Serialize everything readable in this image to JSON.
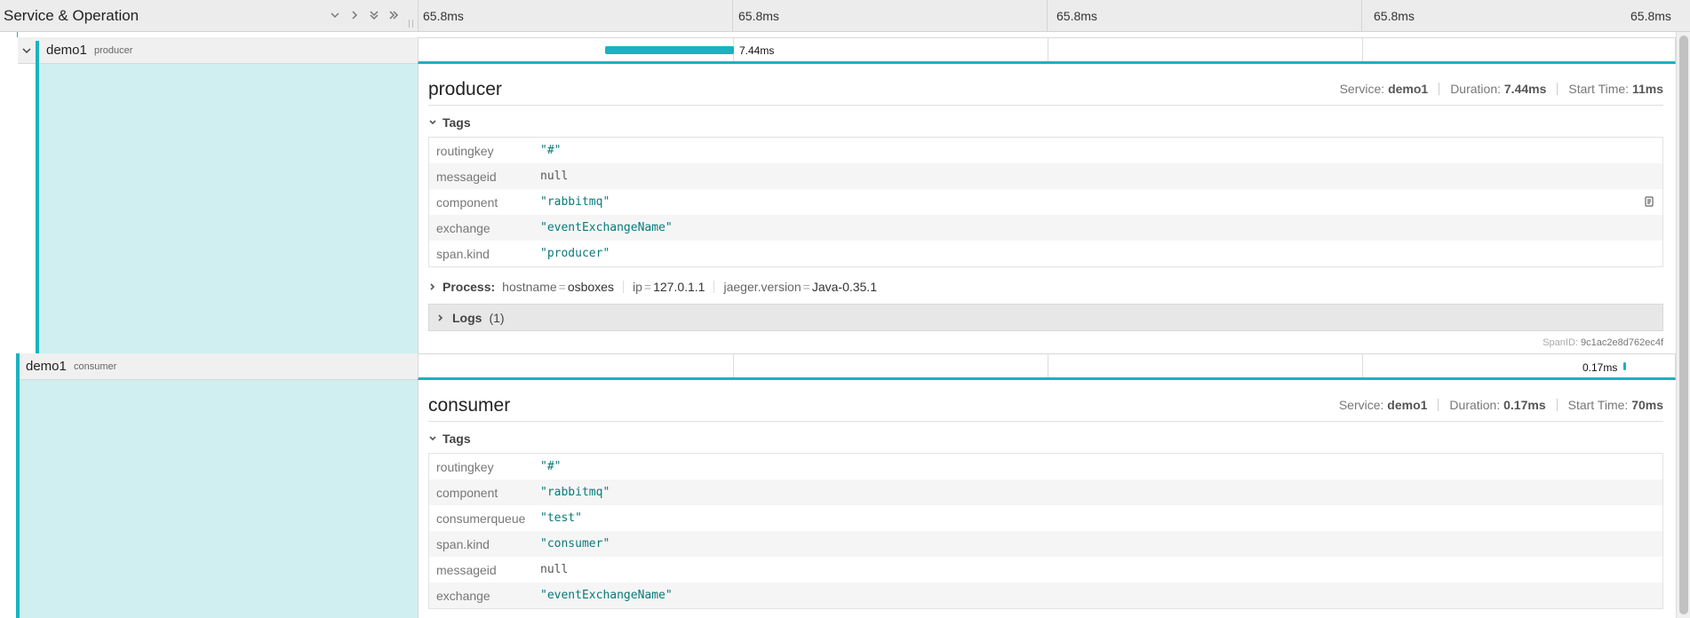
{
  "header": {
    "title": "Service & Operation",
    "ticks": [
      "65.8ms",
      "65.8ms",
      "65.8ms",
      "65.8ms",
      "65.8ms"
    ]
  },
  "rows": [
    {
      "service": "demo1",
      "operation": "producer",
      "bar_label": "7.44ms",
      "detail": {
        "title": "producer",
        "service_label": "Service:",
        "service": "demo1",
        "duration_label": "Duration:",
        "duration": "7.44ms",
        "start_label": "Start Time:",
        "start": "11ms",
        "tags_label": "Tags",
        "tags": [
          {
            "key": "routingkey",
            "value": "\"#\""
          },
          {
            "key": "messageid",
            "value": "null"
          },
          {
            "key": "component",
            "value": "\"rabbitmq\""
          },
          {
            "key": "exchange",
            "value": "\"eventExchangeName\""
          },
          {
            "key": "span.kind",
            "value": "\"producer\""
          }
        ],
        "process_label": "Process:",
        "process": [
          {
            "k": "hostname",
            "v": "osboxes"
          },
          {
            "k": "ip",
            "v": "127.0.1.1"
          },
          {
            "k": "jaeger.version",
            "v": "Java-0.35.1"
          }
        ],
        "logs_label": "Logs",
        "logs_count": "(1)",
        "spanid_label": "SpanID:",
        "spanid": "9c1ac2e8d762ec4f"
      }
    },
    {
      "service": "demo1",
      "operation": "consumer",
      "bar_label": "0.17ms",
      "detail": {
        "title": "consumer",
        "service_label": "Service:",
        "service": "demo1",
        "duration_label": "Duration:",
        "duration": "0.17ms",
        "start_label": "Start Time:",
        "start": "70ms",
        "tags_label": "Tags",
        "tags": [
          {
            "key": "routingkey",
            "value": "\"#\""
          },
          {
            "key": "component",
            "value": "\"rabbitmq\""
          },
          {
            "key": "consumerqueue",
            "value": "\"test\""
          },
          {
            "key": "span.kind",
            "value": "\"consumer\""
          },
          {
            "key": "messageid",
            "value": "null"
          },
          {
            "key": "exchange",
            "value": "\"eventExchangeName\""
          }
        ]
      }
    }
  ],
  "icons": {
    "collapse_one": "chevron-down-icon",
    "expand_one": "chevron-right-icon",
    "collapse_all": "double-chevron-down-icon",
    "expand_all": "double-chevron-right-icon",
    "copy": "clipboard-icon"
  },
  "colors": {
    "accent": "#1ab2bf",
    "detail_bg": "#cfeff1"
  }
}
